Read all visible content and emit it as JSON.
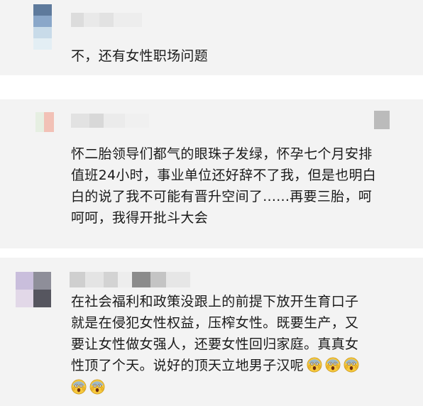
{
  "comments": [
    {
      "text": "不，还有女性职场问题",
      "reaction_emojis": []
    },
    {
      "text": "怀二胎领导们都气的眼珠子发绿，怀孕七个月安排\n值班24小时，事业单位还好辞不了我，但是也明白\n白的说了我不可能有晋升空间了......再要三胎，呵\n呵呵，我得开批斗大会",
      "reaction_emojis": []
    },
    {
      "text": "在社会福利和政策没跟上的前提下放开生育口子\n就是在侵犯女性权益，压榨女性。既要生产，又\n要让女性做女强人，还要女性回归家庭。真真女\n性顶了个天。说好的顶天立地男子汉呢",
      "reaction_emojis": [
        "scream-emoji",
        "scream-emoji",
        "scream-emoji",
        "scream-emoji",
        "scream-emoji"
      ]
    }
  ]
}
